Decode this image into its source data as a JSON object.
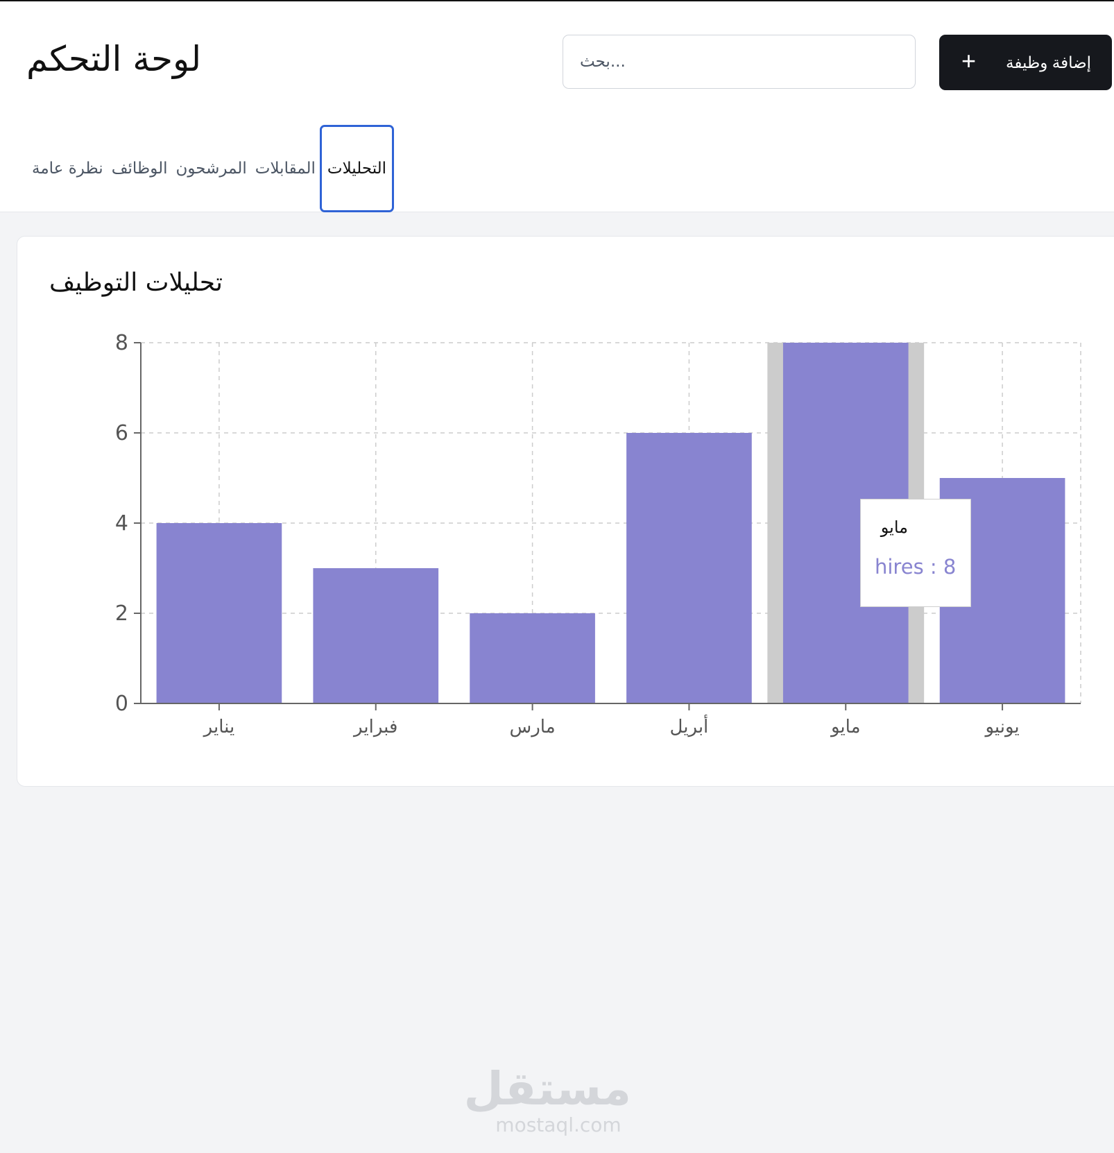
{
  "header": {
    "title": "لوحة التحكم",
    "search": {
      "placeholder": "...بحث",
      "value": ""
    },
    "add_button": {
      "label": "إضافة وظيفة",
      "icon": "plus-icon",
      "icon_glyph": "+"
    }
  },
  "tabs": [
    {
      "label": "نظرة عامة",
      "active": false
    },
    {
      "label": "الوظائف",
      "active": false
    },
    {
      "label": "المرشحون",
      "active": false
    },
    {
      "label": "المقابلات",
      "active": false
    },
    {
      "label": "التحليلات",
      "active": true
    }
  ],
  "card": {
    "title": "تحليلات التوظيف"
  },
  "tooltip": {
    "label": "مايو",
    "value_text": "hires : 8"
  },
  "chart_data": {
    "type": "bar",
    "title": "",
    "xlabel": "",
    "ylabel": "",
    "categories": [
      "يناير",
      "فبراير",
      "مارس",
      "أبريل",
      "مايو",
      "يونيو"
    ],
    "series": [
      {
        "name": "hires",
        "values": [
          4,
          3,
          2,
          6,
          8,
          5
        ]
      }
    ],
    "ylim": [
      0,
      8
    ],
    "yticks": [
      "0",
      "2",
      "4",
      "6",
      "8"
    ],
    "grid": true,
    "highlighted_category": "مايو",
    "colors": {
      "bar": "#8884d0",
      "highlight": "#cccccc",
      "grid": "#cccccc",
      "axis": "#666666"
    }
  },
  "watermark": {
    "arabic": "مستقل",
    "latin": "mostaql.com"
  }
}
